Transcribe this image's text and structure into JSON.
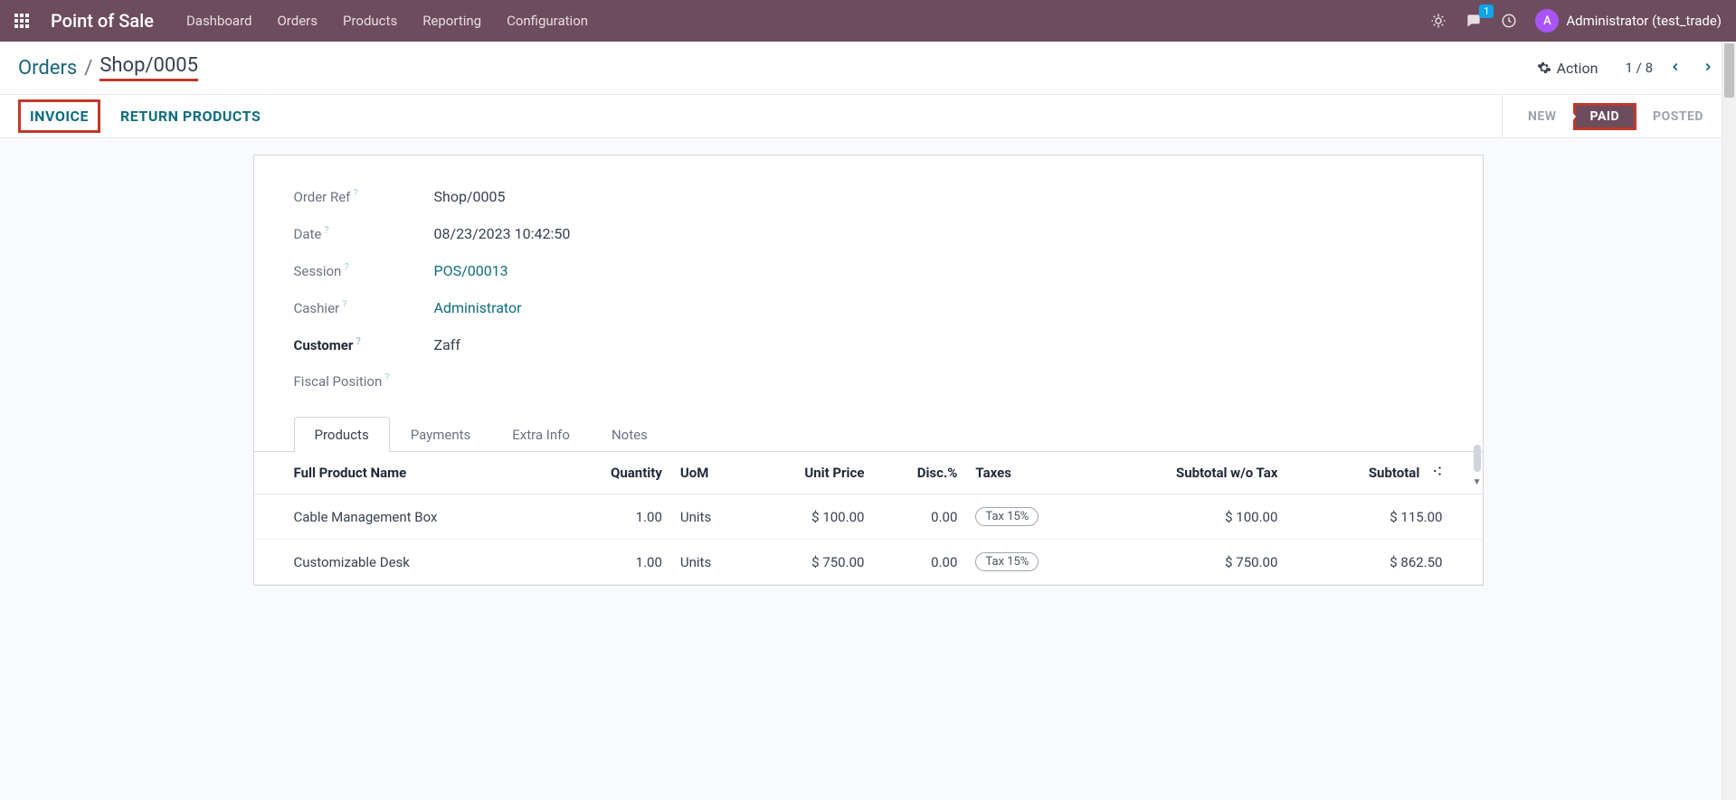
{
  "nav": {
    "brand": "Point of Sale",
    "items": [
      "Dashboard",
      "Orders",
      "Products",
      "Reporting",
      "Configuration"
    ],
    "messages_badge": "1",
    "avatar_initial": "A",
    "username": "Administrator (test_trade)"
  },
  "breadcrumb": {
    "parent": "Orders",
    "current": "Shop/0005"
  },
  "action_label": "Action",
  "pager": {
    "current": "1",
    "total": "8"
  },
  "commands": {
    "invoice": "INVOICE",
    "return_products": "RETURN PRODUCTS"
  },
  "status": {
    "new": "NEW",
    "paid": "PAID",
    "posted": "POSTED"
  },
  "fields": {
    "order_ref_label": "Order Ref",
    "order_ref": "Shop/0005",
    "date_label": "Date",
    "date": "08/23/2023 10:42:50",
    "session_label": "Session",
    "session": "POS/00013",
    "cashier_label": "Cashier",
    "cashier": "Administrator",
    "customer_label": "Customer",
    "customer": "Zaff",
    "fiscal_label": "Fiscal Position"
  },
  "tabs": [
    "Products",
    "Payments",
    "Extra Info",
    "Notes"
  ],
  "table": {
    "headers": {
      "name": "Full Product Name",
      "qty": "Quantity",
      "uom": "UoM",
      "unit_price": "Unit Price",
      "disc": "Disc.%",
      "taxes": "Taxes",
      "subtotal_wo": "Subtotal w/o Tax",
      "subtotal": "Subtotal"
    },
    "rows": [
      {
        "name": "Cable Management Box",
        "qty": "1.00",
        "uom": "Units",
        "unit_price": "$ 100.00",
        "disc": "0.00",
        "tax": "Tax 15%",
        "subtotal_wo": "$ 100.00",
        "subtotal": "$ 115.00"
      },
      {
        "name": "Customizable Desk",
        "qty": "1.00",
        "uom": "Units",
        "unit_price": "$ 750.00",
        "disc": "0.00",
        "tax": "Tax 15%",
        "subtotal_wo": "$ 750.00",
        "subtotal": "$ 862.50"
      }
    ]
  }
}
